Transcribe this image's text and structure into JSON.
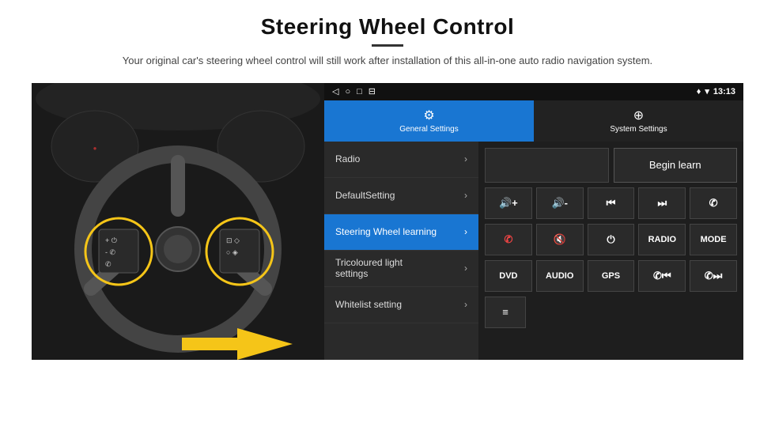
{
  "header": {
    "title": "Steering Wheel Control",
    "subtitle": "Your original car's steering wheel control will still work after installation of this all-in-one auto radio navigation system."
  },
  "status_bar": {
    "left_icons": [
      "◁",
      "○",
      "□",
      "⊟"
    ],
    "right_signal": "♦",
    "right_wifi": "▾",
    "right_time": "13:13"
  },
  "tabs": [
    {
      "label": "General Settings",
      "icon": "⚙",
      "active": true
    },
    {
      "label": "System Settings",
      "icon": "⊕",
      "active": false
    }
  ],
  "menu_items": [
    {
      "label": "Radio",
      "active": false
    },
    {
      "label": "DefaultSetting",
      "active": false
    },
    {
      "label": "Steering Wheel learning",
      "active": true
    },
    {
      "label": "Tricoloured light settings",
      "active": false
    },
    {
      "label": "Whitelist setting",
      "active": false
    }
  ],
  "control_panel": {
    "begin_learn": "Begin learn",
    "buttons_row1": [
      {
        "label": "◀+",
        "icon": true
      },
      {
        "label": "◀-",
        "icon": true
      },
      {
        "label": "⏮",
        "icon": true
      },
      {
        "label": "⏭",
        "icon": true
      },
      {
        "label": "✆",
        "icon": true
      }
    ],
    "buttons_row2": [
      {
        "label": "✆",
        "icon": true
      },
      {
        "label": "🔇",
        "icon": true
      },
      {
        "label": "⏻",
        "icon": true
      },
      {
        "label": "RADIO",
        "icon": false
      },
      {
        "label": "MODE",
        "icon": false
      }
    ],
    "buttons_row3": [
      {
        "label": "DVD",
        "icon": false
      },
      {
        "label": "AUDIO",
        "icon": false
      },
      {
        "label": "GPS",
        "icon": false
      },
      {
        "label": "✆⏮",
        "icon": true
      },
      {
        "label": "✆⏭",
        "icon": true
      }
    ],
    "buttons_row4": [
      {
        "label": "≡",
        "icon": true
      }
    ]
  }
}
